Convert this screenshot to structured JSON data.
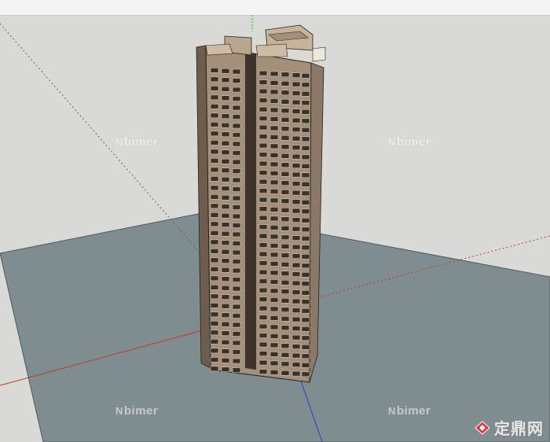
{
  "watermarks": [
    {
      "text": "bimer",
      "mark": "N"
    },
    {
      "text": "bimer",
      "mark": "N"
    },
    {
      "text": "bimer",
      "mark": "N"
    },
    {
      "text": "bimer",
      "mark": "N"
    }
  ],
  "logo": {
    "text": "定鼎网"
  },
  "colors": {
    "sky": "#d9d9d6",
    "ground": "#7f8c90",
    "ground_edge": "#5f6a6e",
    "facade": "#a38f7a",
    "facade_light": "#c7b39a",
    "window": "#3a3128",
    "axis_red": "#c0392b",
    "axis_green": "#3aa84a",
    "axis_blue": "#2b3fd0"
  }
}
